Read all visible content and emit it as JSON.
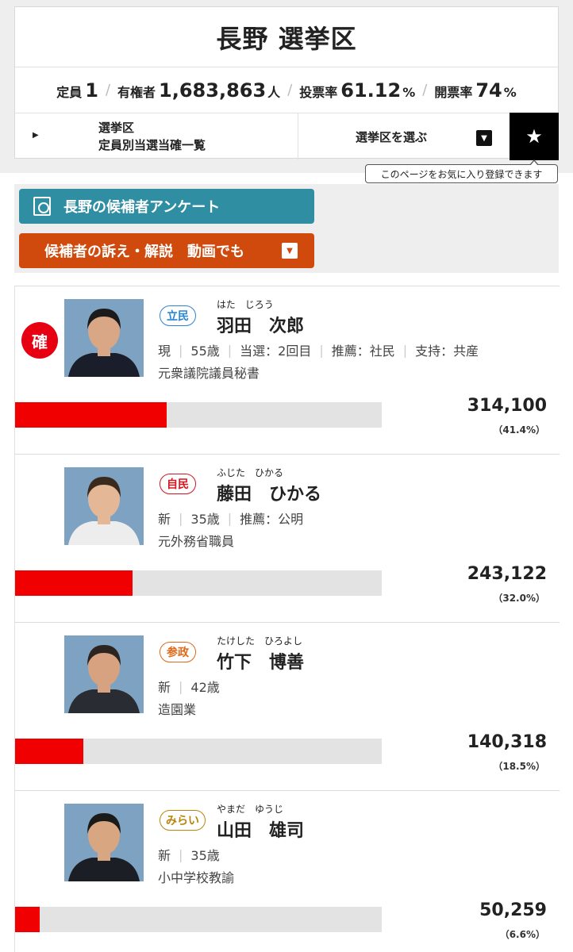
{
  "district": {
    "title": "長野 選挙区"
  },
  "stats": {
    "seats_label": "定員",
    "seats_value": "1",
    "voters_label": "有権者",
    "voters_value": "1,683,863",
    "voters_unit": "人",
    "turnout_label": "投票率",
    "turnout_value": "61.12",
    "turnout_unit": "%",
    "counted_label": "開票率",
    "counted_value": "74",
    "counted_unit": "%"
  },
  "nav": {
    "list_line1": "選挙区",
    "list_line2": "定員別当選当確一覧",
    "select_label": "選挙区を選ぶ",
    "favorite_tooltip": "このページをお気に入り登録できます"
  },
  "buttons": {
    "survey": "長野の候補者アンケート",
    "video": "候補者の訴え・解説　動画でも"
  },
  "elected_mark": "確",
  "candidates": [
    {
      "party": "立民",
      "party_color": "#2a86d6",
      "ruby": "はた　じろう",
      "name": "羽田　次郎",
      "details": [
        "現",
        "55歳",
        "当選：2回目",
        "推薦：社民",
        "支持：共産"
      ],
      "career": "元衆議院議員秘書",
      "votes": "314,100",
      "pct": "（41.4%）",
      "share": 41.4,
      "elected": true,
      "photo_bg": "#7ea3c2",
      "hair": "#1b1b1b",
      "skin": "#d9a785",
      "suit": "#1a1d2a"
    },
    {
      "party": "自民",
      "party_color": "#d7151f",
      "ruby": "ふじた　ひかる",
      "name": "藤田　ひかる",
      "details": [
        "新",
        "35歳",
        "推薦：公明"
      ],
      "career": "元外務省職員",
      "votes": "243,122",
      "pct": "（32.0%）",
      "share": 32.0,
      "elected": false,
      "photo_bg": "#7ea3c2",
      "hair": "#3a2a1e",
      "skin": "#e4b896",
      "suit": "#ededed"
    },
    {
      "party": "参政",
      "party_color": "#e0691a",
      "ruby": "たけした　ひろよし",
      "name": "竹下　博善",
      "details": [
        "新",
        "42歳"
      ],
      "career": "造園業",
      "votes": "140,318",
      "pct": "（18.5%）",
      "share": 18.5,
      "elected": false,
      "photo_bg": "#7ea3c2",
      "hair": "#2b2420",
      "skin": "#d7a27f",
      "suit": "#2a2c33"
    },
    {
      "party": "みらい",
      "party_color": "#b8860b",
      "ruby": "やまだ　ゆうじ",
      "name": "山田　雄司",
      "details": [
        "新",
        "35歳"
      ],
      "career": "小中学校教諭",
      "votes": "50,259",
      "pct": "（6.6%）",
      "share": 6.6,
      "elected": false,
      "photo_bg": "#7ea3c2",
      "hair": "#1a1a1a",
      "skin": "#d9a682",
      "suit": "#1c1e26"
    }
  ]
}
